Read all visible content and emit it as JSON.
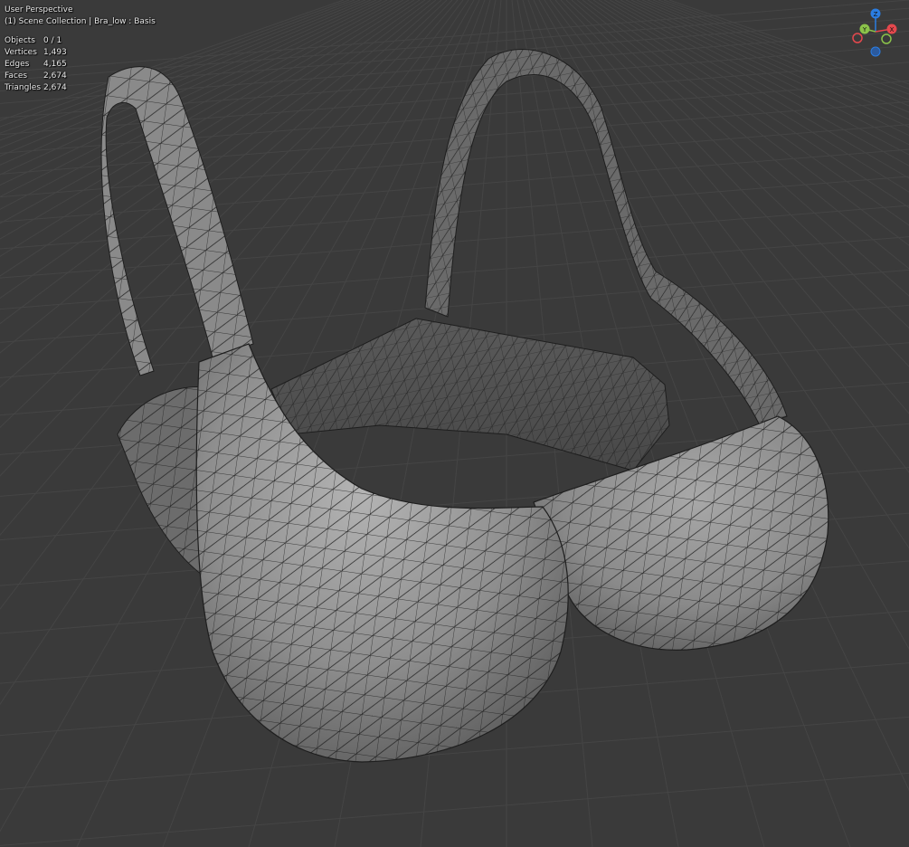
{
  "viewport": {
    "view_name": "User Perspective",
    "collection_path": "(1) Scene Collection | Bra_low : Basis"
  },
  "stats": [
    {
      "label": "Objects",
      "value": "0 / 1"
    },
    {
      "label": "Vertices",
      "value": "1,493"
    },
    {
      "label": "Edges",
      "value": "4,165"
    },
    {
      "label": "Faces",
      "value": "2,674"
    },
    {
      "label": "Triangles",
      "value": "2,674"
    }
  ],
  "gizmo": {
    "axes": [
      {
        "name": "Z",
        "color": "#2b7de1"
      },
      {
        "name": "Y",
        "color": "#8bc34a"
      },
      {
        "name": "X",
        "color": "#e5484d"
      }
    ]
  },
  "colors": {
    "background": "#3a3a3a",
    "grid": "#454545",
    "mesh_fill": "#8c8c8c",
    "wire": "#1a1a1a"
  }
}
